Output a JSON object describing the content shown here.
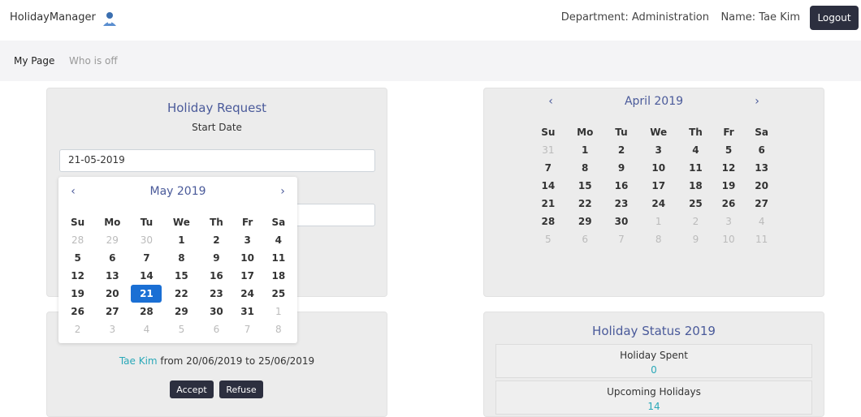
{
  "app": {
    "title": "HolidayManager"
  },
  "header": {
    "department": "Department: Administration",
    "name": "Name: Tae Kim",
    "logout_label": "Logout"
  },
  "nav": {
    "items": [
      "My Page",
      "Who is off"
    ]
  },
  "request_card": {
    "title": "Holiday Request",
    "start_label": "Start Date",
    "start_value": "21-05-2019"
  },
  "datepicker": {
    "month": "May 2019",
    "prev": "‹",
    "next": "›",
    "weekdays": [
      "Su",
      "Mo",
      "Tu",
      "We",
      "Th",
      "Fr",
      "Sa"
    ],
    "weeks": [
      [
        "28",
        "29",
        "30",
        "1",
        "2",
        "3",
        "4"
      ],
      [
        "5",
        "6",
        "7",
        "8",
        "9",
        "10",
        "11"
      ],
      [
        "12",
        "13",
        "14",
        "15",
        "16",
        "17",
        "18"
      ],
      [
        "19",
        "20",
        "21",
        "22",
        "23",
        "24",
        "25"
      ],
      [
        "26",
        "27",
        "28",
        "29",
        "30",
        "31",
        "1"
      ],
      [
        "2",
        "3",
        "4",
        "5",
        "6",
        "7",
        "8"
      ]
    ],
    "selected": "21"
  },
  "calendar": {
    "month": "April 2019",
    "prev": "‹",
    "next": "›",
    "weekdays": [
      "Su",
      "Mo",
      "Tu",
      "We",
      "Th",
      "Fr",
      "Sa"
    ],
    "weeks": [
      [
        "31",
        "1",
        "2",
        "3",
        "4",
        "5",
        "6"
      ],
      [
        "7",
        "8",
        "9",
        "10",
        "11",
        "12",
        "13"
      ],
      [
        "14",
        "15",
        "16",
        "17",
        "18",
        "19",
        "20"
      ],
      [
        "21",
        "22",
        "23",
        "24",
        "25",
        "26",
        "27"
      ],
      [
        "28",
        "29",
        "30",
        "1",
        "2",
        "3",
        "4"
      ],
      [
        "5",
        "6",
        "7",
        "8",
        "9",
        "10",
        "11"
      ]
    ]
  },
  "pending": {
    "name": "Tae Kim",
    "range": " from 20/06/2019 to 25/06/2019",
    "accept_label": "Accept",
    "refuse_label": "Refuse"
  },
  "status": {
    "title": "Holiday Status 2019",
    "spent_label": "Holiday Spent",
    "spent_value": "0",
    "upcoming_label": "Upcoming Holidays",
    "upcoming_value": "14"
  },
  "colors": {
    "accent": "#4a5a9a",
    "dark": "#2c2f3f",
    "selected": "#1a6fd4",
    "teal": "#2aa8b8"
  }
}
